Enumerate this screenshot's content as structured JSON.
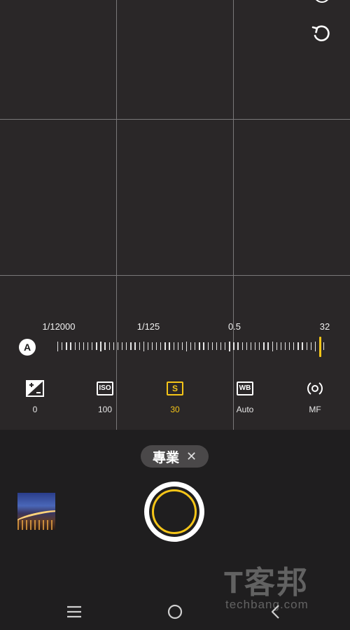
{
  "viewfinder": {
    "grid": "3x3"
  },
  "top_controls": {
    "reset_icon": "rotate-reset-icon"
  },
  "shutter_scale": {
    "labels": [
      "1/12000",
      "1/125",
      "0.5",
      "32"
    ],
    "auto_label": "A",
    "indicator_color": "#f5c518"
  },
  "modes": [
    {
      "key": "ev",
      "icon": "exposure-compensation-icon",
      "value": "0",
      "active": false
    },
    {
      "key": "iso",
      "icon": "iso-icon",
      "icon_text": "ISO",
      "value": "100",
      "active": false
    },
    {
      "key": "shutter",
      "icon": "shutter-speed-icon",
      "icon_text": "S",
      "value": "30",
      "active": true
    },
    {
      "key": "wb",
      "icon": "white-balance-icon",
      "icon_text": "WB",
      "value": "Auto",
      "active": false
    },
    {
      "key": "focus",
      "icon": "focus-icon",
      "value": "MF",
      "active": false
    }
  ],
  "mode_chip": {
    "label": "專業",
    "close": "✕"
  },
  "gallery": {
    "icon": "gallery-thumbnail"
  },
  "shutter": {
    "accent": "#f5c518"
  },
  "watermark": {
    "cn": "T客邦",
    "en": "techbang.com"
  },
  "navbar": {
    "items": [
      "menu-icon",
      "home-icon",
      "back-icon"
    ]
  },
  "colors": {
    "accent": "#f5c518",
    "background": "#2a2728",
    "panel": "#1f1e1f"
  }
}
